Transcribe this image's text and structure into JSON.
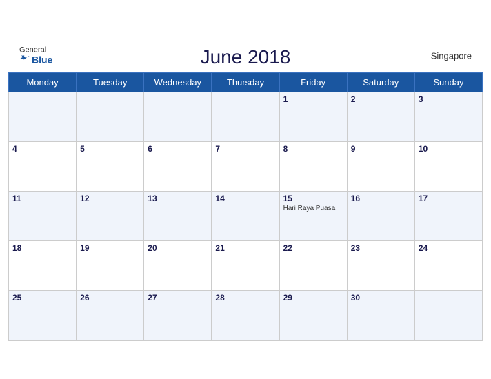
{
  "header": {
    "title": "June 2018",
    "location": "Singapore",
    "brand_general": "General",
    "brand_blue": "Blue"
  },
  "weekdays": [
    "Monday",
    "Tuesday",
    "Wednesday",
    "Thursday",
    "Friday",
    "Saturday",
    "Sunday"
  ],
  "weeks": [
    [
      {
        "day": "",
        "empty": true
      },
      {
        "day": "",
        "empty": true
      },
      {
        "day": "",
        "empty": true
      },
      {
        "day": "",
        "empty": true
      },
      {
        "day": "1"
      },
      {
        "day": "2"
      },
      {
        "day": "3"
      }
    ],
    [
      {
        "day": "4"
      },
      {
        "day": "5"
      },
      {
        "day": "6"
      },
      {
        "day": "7"
      },
      {
        "day": "8"
      },
      {
        "day": "9"
      },
      {
        "day": "10"
      }
    ],
    [
      {
        "day": "11"
      },
      {
        "day": "12"
      },
      {
        "day": "13"
      },
      {
        "day": "14"
      },
      {
        "day": "15",
        "event": "Hari Raya Puasa"
      },
      {
        "day": "16"
      },
      {
        "day": "17"
      }
    ],
    [
      {
        "day": "18"
      },
      {
        "day": "19"
      },
      {
        "day": "20"
      },
      {
        "day": "21"
      },
      {
        "day": "22"
      },
      {
        "day": "23"
      },
      {
        "day": "24"
      }
    ],
    [
      {
        "day": "25"
      },
      {
        "day": "26"
      },
      {
        "day": "27"
      },
      {
        "day": "28"
      },
      {
        "day": "29"
      },
      {
        "day": "30"
      },
      {
        "day": "",
        "empty": true
      }
    ]
  ]
}
